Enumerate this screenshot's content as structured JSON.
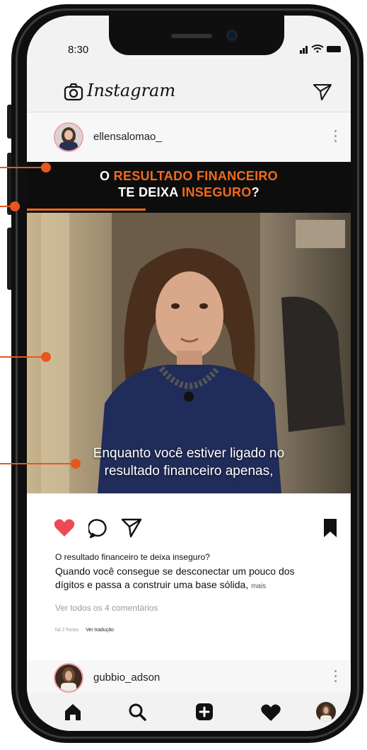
{
  "status_bar": {
    "time": "8:30"
  },
  "header": {
    "app_name": "Instagram",
    "camera_icon": "camera-icon",
    "direct_icon": "paper-plane-icon"
  },
  "post": {
    "username": "ellensalomao_",
    "banner": {
      "line1_prefix": "O ",
      "line1_highlight": "RESULTADO FINANCEIRO",
      "line2_prefix": "TE DEIXA ",
      "line2_highlight": "INSEGURO",
      "line2_suffix": "?"
    },
    "subtitle_line1": "Enquanto você estiver ligado no",
    "subtitle_line2": "resultado financeiro apenas,",
    "liked": true,
    "caption_title": "O resultado financeiro te deixa inseguro?",
    "caption_body": "Quando você consegue se desconectar um pouco dos dígitos e passa a construir uma base sólida,",
    "more_label": "mais",
    "view_comments": "Ver todos os 4 comentários",
    "time_ago": "há 2 horas",
    "separator": "·",
    "translate_label": "Ver tradução"
  },
  "next_post": {
    "username": "gubbio_adson"
  },
  "bottom_nav": {
    "items": [
      "home-icon",
      "search-icon",
      "add-icon",
      "heart-icon",
      "profile-avatar"
    ]
  },
  "colors": {
    "accent_orange": "#f26a1b",
    "like_red": "#ed4956",
    "banner_bg": "#0d0d0d"
  }
}
